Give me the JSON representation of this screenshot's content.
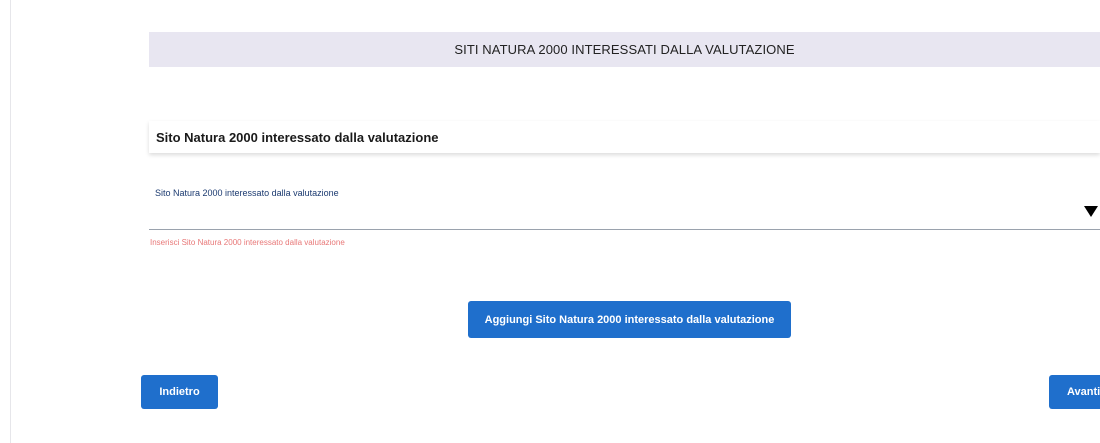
{
  "section": {
    "banner_title": "SITI NATURA 2000 INTERESSATI DALLA VALUTAZIONE"
  },
  "card": {
    "title": "Sito Natura 2000 interessato dalla valutazione"
  },
  "form": {
    "site_select": {
      "label": "Sito Natura 2000 interessato dalla valutazione",
      "value": "",
      "error": "Inserisci Sito Natura 2000 interessato dalla valutazione"
    }
  },
  "actions": {
    "add_label": "Aggiungi Sito Natura 2000 interessato dalla valutazione",
    "back_label": "Indietro",
    "next_label": "Avanti"
  },
  "colors": {
    "primary": "#1f6fcc",
    "banner_bg": "#e8e6f1",
    "error": "#e87878",
    "label": "#1b3a70"
  }
}
